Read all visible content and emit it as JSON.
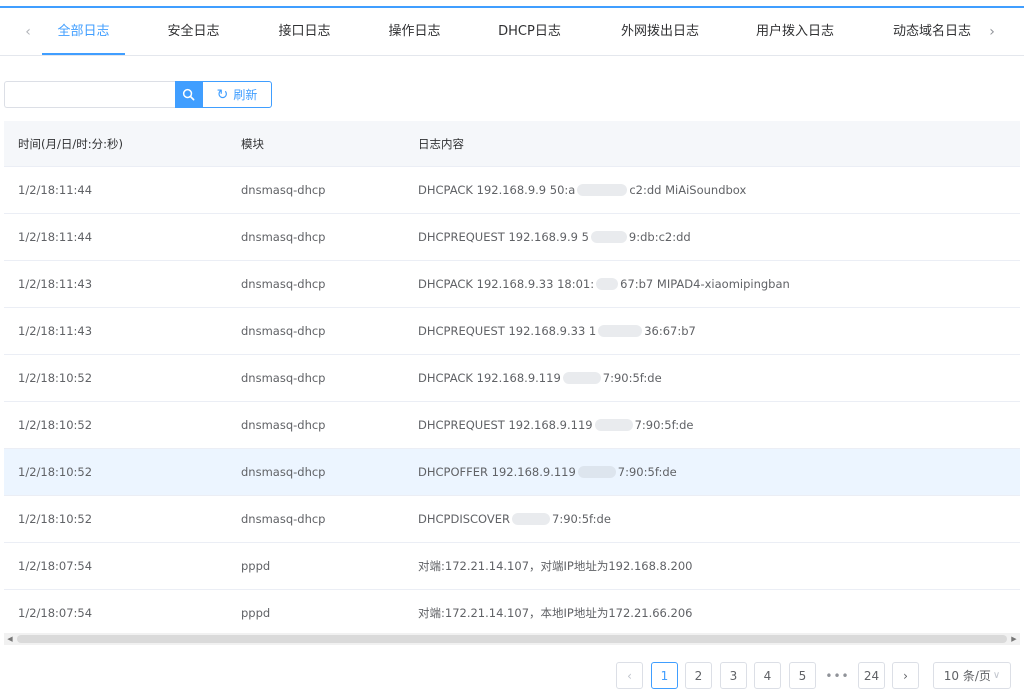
{
  "tabs": {
    "items": [
      "全部日志",
      "安全日志",
      "接口日志",
      "操作日志",
      "DHCP日志",
      "外网拨出日志",
      "用户拨入日志",
      "动态域名日志"
    ],
    "active": 0
  },
  "search": {
    "value": "",
    "placeholder": "",
    "refresh_label": "刷新"
  },
  "table": {
    "columns": [
      "时间(月/日/时:分:秒)",
      "模块",
      "日志内容"
    ],
    "rows": [
      {
        "time": "1/2/18:11:44",
        "module": "dnsmasq-dhcp",
        "content_a": "DHCPACK 192.168.9.9 50:a",
        "content_b": "c2:dd MiAiSoundbox"
      },
      {
        "time": "1/2/18:11:44",
        "module": "dnsmasq-dhcp",
        "content_a": "DHCPREQUEST 192.168.9.9 5",
        "content_b": "9:db:c2:dd"
      },
      {
        "time": "1/2/18:11:43",
        "module": "dnsmasq-dhcp",
        "content_a": "DHCPACK 192.168.9.33 18:01:",
        "content_b": "67:b7 MIPAD4-xiaomipingban"
      },
      {
        "time": "1/2/18:11:43",
        "module": "dnsmasq-dhcp",
        "content_a": "DHCPREQUEST 192.168.9.33 1",
        "content_b": "36:67:b7"
      },
      {
        "time": "1/2/18:10:52",
        "module": "dnsmasq-dhcp",
        "content_a": "DHCPACK 192.168.9.119",
        "content_b": "7:90:5f:de"
      },
      {
        "time": "1/2/18:10:52",
        "module": "dnsmasq-dhcp",
        "content_a": "DHCPREQUEST 192.168.9.119",
        "content_b": "7:90:5f:de"
      },
      {
        "time": "1/2/18:10:52",
        "module": "dnsmasq-dhcp",
        "content_a": "DHCPOFFER 192.168.9.119",
        "content_b": "7:90:5f:de"
      },
      {
        "time": "1/2/18:10:52",
        "module": "dnsmasq-dhcp",
        "content_a": "DHCPDISCOVER",
        "content_b": "7:90:5f:de"
      },
      {
        "time": "1/2/18:07:54",
        "module": "pppd",
        "content_a": "对端:172.21.14.107，对端IP地址为192.168.8.200",
        "content_b": ""
      },
      {
        "time": "1/2/18:07:54",
        "module": "pppd",
        "content_a": "对端:172.21.14.107，本地IP地址为172.21.66.206",
        "content_b": ""
      }
    ],
    "highlighted_row": 6
  },
  "pagination": {
    "pages": [
      "1",
      "2",
      "3",
      "4",
      "5"
    ],
    "current": "1",
    "ellipsis": "•••",
    "last_page": "24",
    "page_size": "10 条/页"
  },
  "colors": {
    "accent": "#409eff",
    "header_bg": "#f5f7fa",
    "row_highlight": "#ecf5ff"
  }
}
